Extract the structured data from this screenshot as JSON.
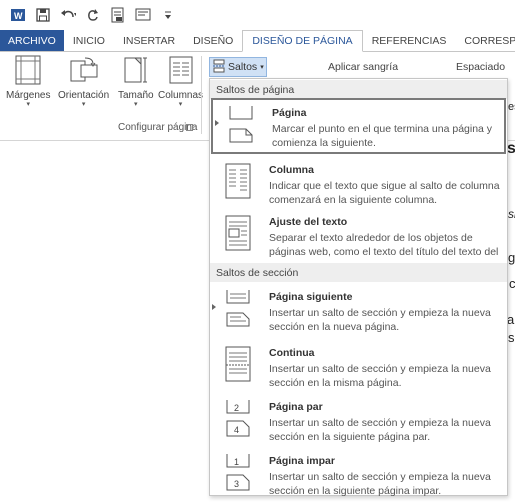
{
  "quick_access": {
    "icons": [
      "word-app-icon",
      "save-icon",
      "undo-icon",
      "redo-icon",
      "print-preview-icon",
      "quick-print-icon",
      "customize-toolbar-icon"
    ]
  },
  "tabs": [
    "ARCHIVO",
    "INICIO",
    "INSERTAR",
    "DISEÑO",
    "DISEÑO DE PÁGINA",
    "REFERENCIAS",
    "CORRESPON"
  ],
  "ribbon": {
    "buttons": {
      "margins": "Márgenes",
      "orientation": "Orientación",
      "size": "Tamaño",
      "columns": "Columnas"
    },
    "group_label": "Configurar página",
    "breaks_button": "Saltos",
    "indent_label": "Aplicar sangría",
    "spacing_label": "Espaciado"
  },
  "document_fragments": [
    "es",
    "s",
    "sk",
    "gi",
    "c",
    "al",
    "s\""
  ],
  "menu": {
    "page_breaks_header": "Saltos de página",
    "section_breaks_header": "Saltos de sección",
    "items": [
      {
        "title": "Página",
        "description": "Marcar el punto en el que termina una página y comienza la siguiente."
      },
      {
        "title": "Columna",
        "description": "Indicar que el texto que sigue al salto de columna comenzará en la siguiente columna."
      },
      {
        "title": "Ajuste del texto",
        "description": "Separar el texto alrededor de los objetos de páginas web, como el texto del título del texto del cuerpo."
      },
      {
        "title": "Página siguiente",
        "description": "Insertar un salto de sección y empieza la nueva sección en la nueva página."
      },
      {
        "title": "Continua",
        "description": "Insertar un salto de sección y empieza la nueva sección en la misma página."
      },
      {
        "title": "Página par",
        "description": "Insertar un salto de sección y empieza la nueva sección en la siguiente página par."
      },
      {
        "title": "Página impar",
        "description": "Insertar un salto de sección y empieza la nueva sección en la siguiente página impar."
      }
    ]
  },
  "colors": {
    "file_tab": "#2b579a",
    "active_tab_text": "#2b579a",
    "breaks_button_bg": "#d0e1f5",
    "highlight_border": "#7a7a7a"
  }
}
